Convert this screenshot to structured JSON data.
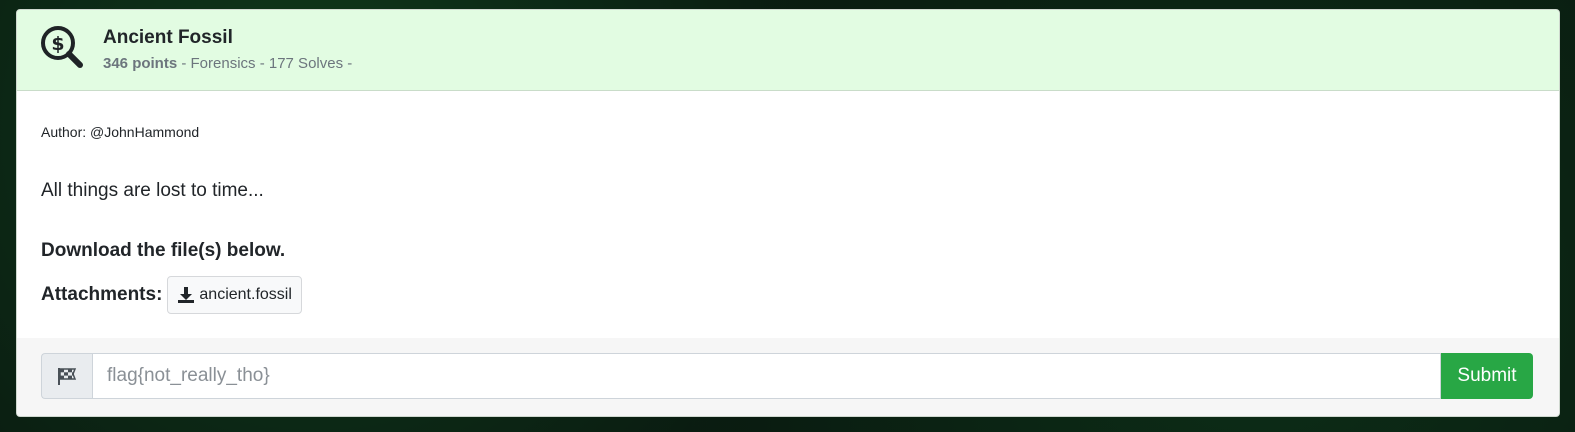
{
  "challenge": {
    "title": "Ancient Fossil",
    "points": "346 points",
    "meta_rest": " - Forensics - 177 Solves -",
    "icon": "search-dollar-icon"
  },
  "description": {
    "author": "Author: @JohnHammond",
    "text": "All things are lost to time...",
    "download_note": "Download the file(s) below."
  },
  "attachments": {
    "label": "Attachments:",
    "files": [
      {
        "name": "ancient.fossil",
        "icon": "download-icon"
      }
    ]
  },
  "submission": {
    "flag_icon": "checkered-flag-icon",
    "placeholder": "flag{not_really_tho}",
    "value": "",
    "submit_label": "Submit"
  },
  "colors": {
    "header_bg": "#e2fce2",
    "submit_bg": "#28a745",
    "text": "#212529"
  }
}
